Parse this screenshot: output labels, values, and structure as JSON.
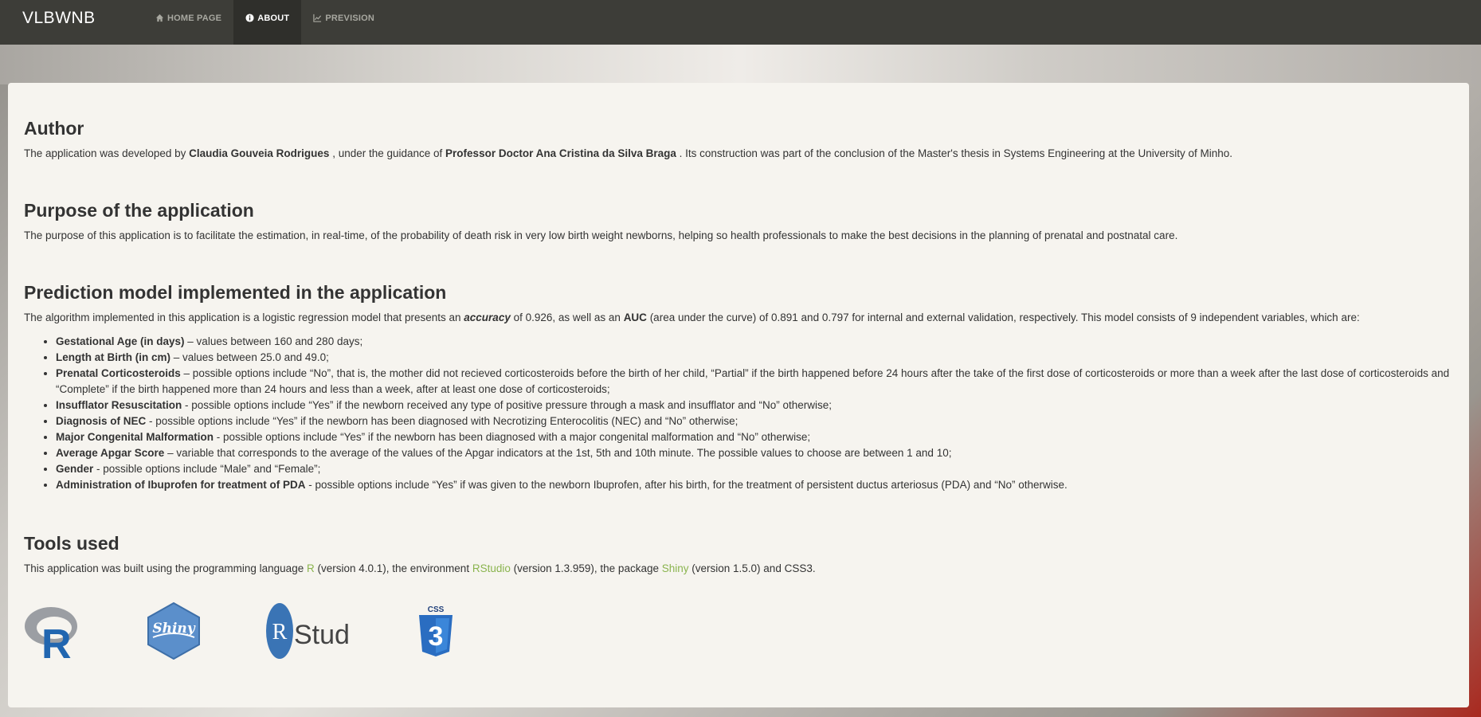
{
  "navbar": {
    "brand": "VLBWNB",
    "items": [
      {
        "label": "HOME PAGE",
        "icon": "home-icon"
      },
      {
        "label": "ABOUT",
        "icon": "info-icon"
      },
      {
        "label": "PREVISION",
        "icon": "line-chart-icon"
      }
    ]
  },
  "author": {
    "title": "Author",
    "text1": "The application was developed by ",
    "name": "Claudia Gouveia Rodrigues",
    "text2": " , under the guidance of ",
    "advisor": "Professor Doctor Ana Cristina da Silva Braga",
    "text3": " . Its construction was part of the conclusion of the Master's thesis in Systems Engineering at the University of Minho."
  },
  "purpose": {
    "title": "Purpose of the application",
    "text": "The purpose of this application is to facilitate the estimation, in real-time, of the probability of death risk in very low birth weight newborns, helping so health professionals to make the best decisions in the planning of prenatal and postnatal care."
  },
  "model": {
    "title": "Prediction model implemented in the application",
    "text1": "The algorithm implemented in this application is a logistic regression model that presents an ",
    "accuracy_word": "accuracy",
    "text2": " of 0.926, as well as an ",
    "auc_word": "AUC",
    "text3": " (area under the curve) of 0.891 and 0.797 for internal and external validation, respectively. This model consists of 9 independent variables, which are:",
    "variables": [
      {
        "name": "Gestational Age (in days)",
        "desc": " – values between 160 and 280 days;"
      },
      {
        "name": "Length at Birth (in cm)",
        "desc": " – values between 25.0 and 49.0;"
      },
      {
        "name": "Prenatal Corticosteroids",
        "desc": " – possible options include “No”, that is, the mother did not recieved corticosteroids before the birth of her child, “Partial” if the birth happened before 24 hours after the take of the first dose of corticosteroids or more than a week after the last dose of corticosteroids and “Complete” if the birth happened more than 24 hours and less than a week, after at least one dose of corticosteroids;"
      },
      {
        "name": "Insufflator Resuscitation",
        "desc": " - possible options include “Yes” if the newborn received any type of positive pressure through a mask and insufflator and “No” otherwise;"
      },
      {
        "name": "Diagnosis of NEC",
        "desc": " - possible options include “Yes” if the newborn has been diagnosed with Necrotizing Enterocolitis (NEC) and “No” otherwise;"
      },
      {
        "name": "Major Congenital Malformation",
        "desc": " - possible options include “Yes” if the newborn has been diagnosed with a major congenital malformation and “No” otherwise;"
      },
      {
        "name": "Average Apgar Score",
        "desc": " – variable that corresponds to the average of the values of the Apgar indicators at the 1st, 5th and 10th minute. The possible values to choose are between 1 and 10;"
      },
      {
        "name": "Gender",
        "desc": " - possible options include “Male” and “Female”;"
      },
      {
        "name": "Administration of Ibuprofen for treatment of PDA",
        "desc": " - possible options include “Yes” if was given to the newborn Ibuprofen, after his birth, for the treatment of persistent ductus arteriosus (PDA) and “No” otherwise."
      }
    ]
  },
  "tools": {
    "title": "Tools used",
    "text1": "This application was built using the programming language ",
    "r_link": "R",
    "text2": " (version 4.0.1), the environment ",
    "rstudio_link": "RStudio",
    "text3": " (version 1.3.959), the package ",
    "shiny_link": "Shiny",
    "text4": " (version 1.5.0) and CSS3.",
    "logos": {
      "r": "R",
      "shiny": "Shiny",
      "rstudio": "Studio",
      "css_top": "CSS",
      "css_num": "3"
    }
  },
  "colors": {
    "navbar": "#3d3d38",
    "link": "#8ab44e",
    "panel": "#f6f4ef"
  }
}
